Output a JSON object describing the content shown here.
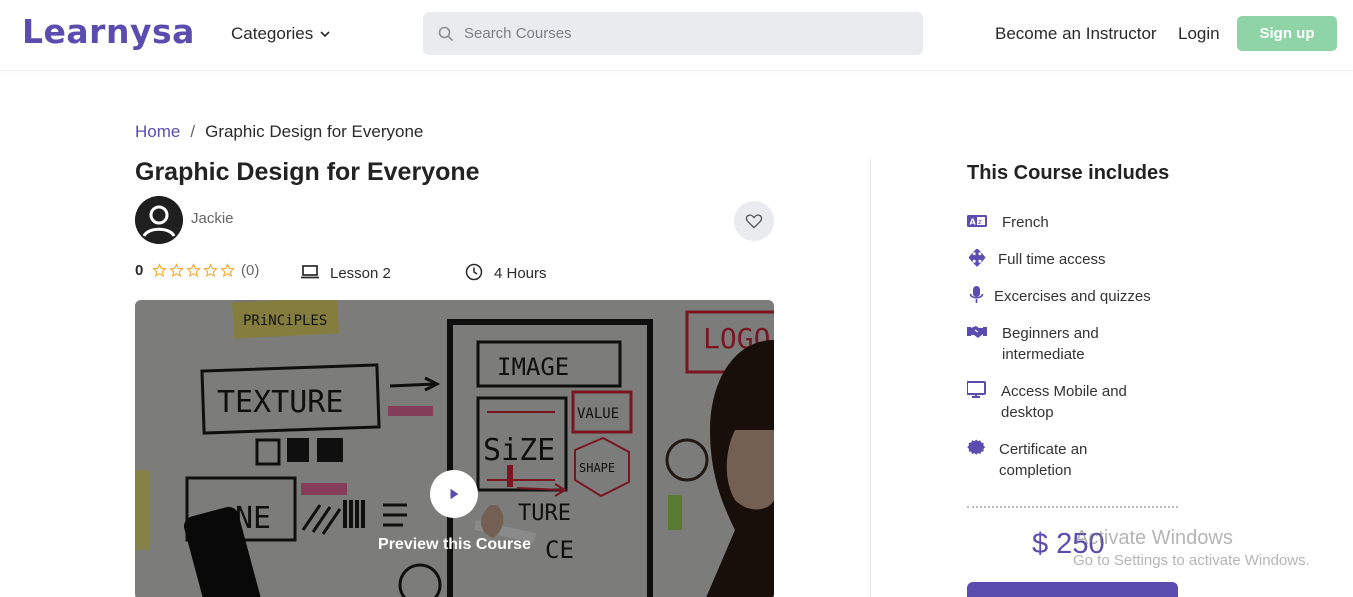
{
  "header": {
    "logo": "Learnysa",
    "categories_label": "Categories",
    "search_placeholder": "Search Courses",
    "instructor_label": "Become an Instructor",
    "login_label": "Login",
    "signup_label": "Sign up"
  },
  "breadcrumb": {
    "home": "Home",
    "separator": "/",
    "current": "Graphic Design for Everyone"
  },
  "course": {
    "title": "Graphic Design for Everyone",
    "author": "Jackie",
    "rating": "0",
    "rating_stars_filled": 0,
    "rating_count": "(0)",
    "lessons": "Lesson 2",
    "duration": "4 Hours",
    "preview_label": "Preview this Course"
  },
  "sidebar": {
    "title": "This Course includes",
    "items": [
      {
        "icon": "language-icon",
        "label": "French"
      },
      {
        "icon": "move-arrows-icon",
        "label": "Full time access"
      },
      {
        "icon": "microphone-icon",
        "label": "Excercises and quizzes"
      },
      {
        "icon": "handshake-icon",
        "label": "Beginners and intermediate"
      },
      {
        "icon": "desktop-icon",
        "label": "Access Mobile and desktop"
      },
      {
        "icon": "certificate-icon",
        "label": "Certificate an completion"
      }
    ],
    "price": "$ 250"
  },
  "watermark": {
    "line1": "Activate Windows",
    "line2": "Go to Settings to activate Windows."
  },
  "colors": {
    "brand": "#5b4cb0",
    "signup": "#8fd4a7",
    "star": "#f5a623"
  }
}
